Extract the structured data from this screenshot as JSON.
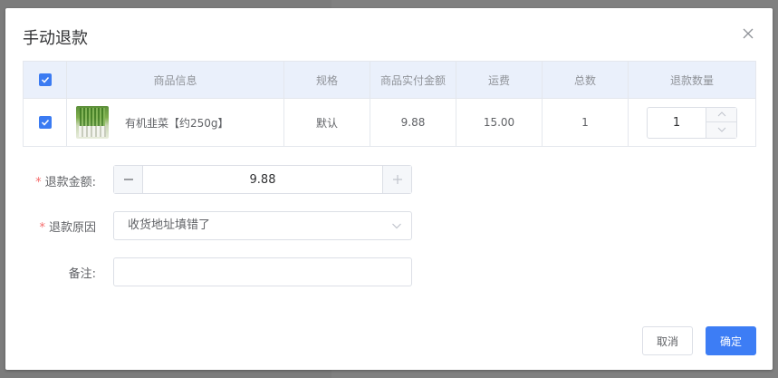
{
  "dialog": {
    "title": "手动退款"
  },
  "table": {
    "headers": [
      "商品信息",
      "规格",
      "商品实付金额",
      "运费",
      "总数",
      "退款数量"
    ],
    "rows": [
      {
        "name": "有机韭菜【约250g】",
        "spec": "默认",
        "paid": "9.88",
        "shipping": "15.00",
        "total": "1",
        "refund_qty": "1"
      }
    ]
  },
  "form": {
    "amount_label": "退款金额:",
    "amount_value": "9.88",
    "reason_label": "退款原因",
    "reason_value": "收货地址填错了",
    "note_label": "备注:",
    "note_value": ""
  },
  "buttons": {
    "cancel": "取消",
    "confirm": "确定"
  },
  "colors": {
    "primary": "#3d7df5",
    "required": "#f56c6c",
    "header_bg": "#eaf0fb"
  }
}
